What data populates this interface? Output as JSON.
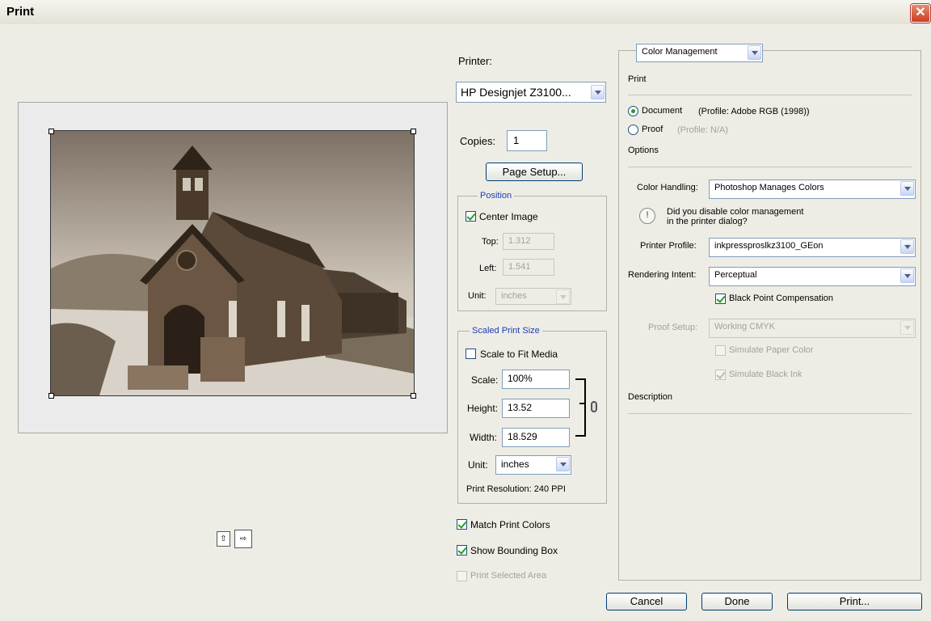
{
  "window": {
    "title": "Print",
    "close_icon": "close-icon"
  },
  "printer": {
    "label": "Printer:",
    "value": "HP Designjet Z3100..."
  },
  "copies": {
    "label": "Copies:",
    "value": "1"
  },
  "page_setup_label": "Page Setup...",
  "position": {
    "title": "Position",
    "center_image_label": "Center Image",
    "center_image_checked": true,
    "top_label": "Top:",
    "top_value": "1.312",
    "left_label": "Left:",
    "left_value": "1.541",
    "unit_label": "Unit:",
    "unit_value": "inches"
  },
  "scaled": {
    "title": "Scaled Print Size",
    "scale_to_fit_label": "Scale to Fit Media",
    "scale_to_fit_checked": false,
    "scale_label": "Scale:",
    "scale_value": "100%",
    "height_label": "Height:",
    "height_value": "13.52",
    "width_label": "Width:",
    "width_value": "18.529",
    "unit_label": "Unit:",
    "unit_value": "inches",
    "resolution": "Print Resolution: 240 PPI"
  },
  "options_left": {
    "match_colors": "Match Print Colors",
    "show_bbox": "Show Bounding Box",
    "print_selected": "Print Selected Area"
  },
  "color_mgmt": {
    "dropdown_value": "Color Management",
    "print_heading": "Print",
    "document_label": "Document",
    "document_profile": "(Profile: Adobe RGB (1998))",
    "proof_label": "Proof",
    "proof_profile": "(Profile: N/A)",
    "options_heading": "Options",
    "color_handling_label": "Color Handling:",
    "color_handling_value": "Photoshop Manages Colors",
    "warning_text_1": "Did you disable color management",
    "warning_text_2": "in the printer dialog?",
    "printer_profile_label": "Printer Profile:",
    "printer_profile_value": "inkpressproslkz3100_GEon",
    "rendering_intent_label": "Rendering Intent:",
    "rendering_intent_value": "Perceptual",
    "bpc_label": "Black Point Compensation",
    "proof_setup_label": "Proof Setup:",
    "proof_setup_value": "Working CMYK",
    "simulate_paper_label": "Simulate Paper Color",
    "simulate_ink_label": "Simulate Black Ink",
    "description_heading": "Description"
  },
  "buttons": {
    "cancel": "Cancel",
    "done": "Done",
    "print": "Print..."
  }
}
